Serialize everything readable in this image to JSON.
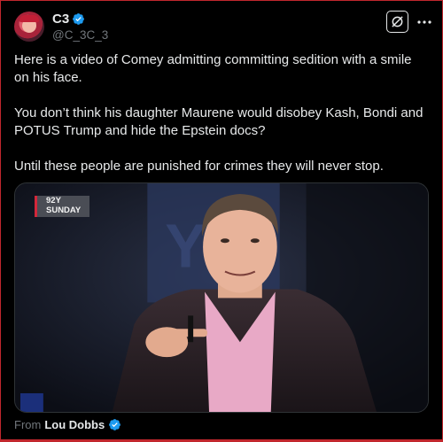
{
  "post": {
    "author": {
      "display_name": "C3",
      "handle": "@C_3C_3",
      "verified": true
    },
    "paragraphs": [
      "Here is a video of Comey admitting committing sedition with a smile on his face.",
      "You don’t think his daughter Maurene would disobey Kash, Bondi and POTUS Trump and hide the Epstein docs?",
      "Until these people are punished for crimes they will never stop."
    ],
    "media": {
      "type": "video",
      "watermark_line1": "92Y",
      "watermark_line2": "SUNDAY"
    },
    "source": {
      "prefix": "From",
      "name": "Lou Dobbs",
      "verified": true
    }
  },
  "icons": {
    "grok": "grok-icon",
    "more": "more-options-icon",
    "verified": "verified-badge-icon"
  },
  "colors": {
    "background": "#000000",
    "text": "#e7e9ea",
    "muted": "#71767b",
    "verified": "#1d9bf0",
    "frame": "#c1272d"
  }
}
